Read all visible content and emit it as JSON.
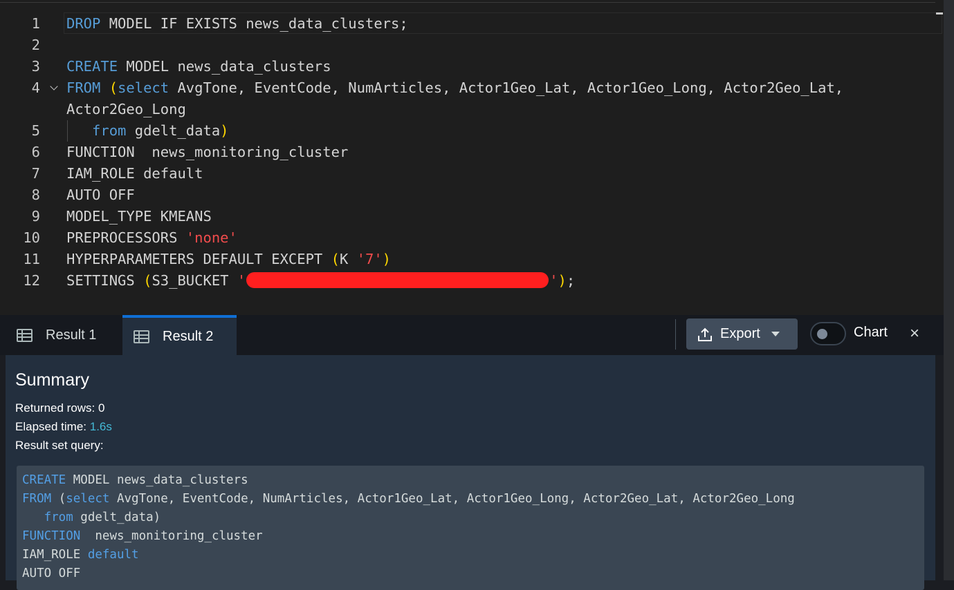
{
  "editor": {
    "lines": [
      {
        "num": "1",
        "parts": [
          {
            "t": "DROP",
            "c": "kw"
          },
          {
            "t": " MODEL IF EXISTS news_data_clusters;"
          }
        ]
      },
      {
        "num": "2",
        "parts": []
      },
      {
        "num": "3",
        "parts": [
          {
            "t": "CREATE",
            "c": "kw"
          },
          {
            "t": " MODEL news_data_clusters"
          }
        ]
      },
      {
        "num": "4",
        "fold": true,
        "parts": [
          {
            "t": "FROM",
            "c": "kw"
          },
          {
            "t": " "
          },
          {
            "t": "(",
            "c": "par"
          },
          {
            "t": "select",
            "c": "kw"
          },
          {
            "t": " AvgTone, EventCode, NumArticles, Actor1Geo_Lat, Actor1Geo_Long, Actor2Geo_Lat,"
          }
        ]
      },
      {
        "num": "",
        "parts": [
          {
            "t": "Actor2Geo_Long"
          }
        ]
      },
      {
        "num": "5",
        "parts": [
          {
            "t": "   "
          },
          {
            "t": "from",
            "c": "kw"
          },
          {
            "t": " gdelt_data"
          },
          {
            "t": ")",
            "c": "par"
          }
        ]
      },
      {
        "num": "6",
        "parts": [
          {
            "t": "FUNCTION  news_monitoring_cluster"
          }
        ]
      },
      {
        "num": "7",
        "parts": [
          {
            "t": "IAM_ROLE default"
          }
        ]
      },
      {
        "num": "8",
        "parts": [
          {
            "t": "AUTO OFF"
          }
        ]
      },
      {
        "num": "9",
        "parts": [
          {
            "t": "MODEL_TYPE KMEANS"
          }
        ]
      },
      {
        "num": "10",
        "parts": [
          {
            "t": "PREPROCESSORS "
          },
          {
            "t": "'none'",
            "c": "str"
          }
        ]
      },
      {
        "num": "11",
        "parts": [
          {
            "t": "HYPERPARAMETERS DEFAULT EXCEPT "
          },
          {
            "t": "(",
            "c": "par"
          },
          {
            "t": "K "
          },
          {
            "t": "'7'",
            "c": "str"
          },
          {
            "t": ")",
            "c": "par"
          }
        ]
      },
      {
        "num": "12",
        "parts": [
          {
            "t": "SETTINGS "
          },
          {
            "t": "(",
            "c": "par"
          },
          {
            "t": "S3_BUCKET "
          },
          {
            "t": "'",
            "c": "str"
          },
          {
            "redact": true
          },
          {
            "t": "'",
            "c": "str"
          },
          {
            "t": ")",
            "c": "par"
          },
          {
            "t": ";"
          }
        ]
      }
    ]
  },
  "tabs": [
    {
      "label": "Result 1",
      "active": false
    },
    {
      "label": "Result 2",
      "active": true
    }
  ],
  "toolbar": {
    "export_label": "Export",
    "chart_label": "Chart",
    "chart_toggle_on": false,
    "close_symbol": "×"
  },
  "summary": {
    "title": "Summary",
    "returned_rows_label": "Returned rows: 0",
    "elapsed_label": "Elapsed time:",
    "elapsed_value": "1.6s",
    "result_set_label": "Result set query:"
  },
  "query": {
    "lines": [
      [
        {
          "t": "CREATE",
          "c": "kw"
        },
        {
          "t": " MODEL news_data_clusters"
        }
      ],
      [
        {
          "t": "FROM",
          "c": "kw"
        },
        {
          "t": " ("
        },
        {
          "t": "select",
          "c": "kw"
        },
        {
          "t": " AvgTone, EventCode, NumArticles, Actor1Geo_Lat, Actor1Geo_Long, Actor2Geo_Lat, Actor2Geo_Long"
        }
      ],
      [
        {
          "t": "   "
        },
        {
          "t": "from",
          "c": "kw"
        },
        {
          "t": " gdelt_data)"
        }
      ],
      [
        {
          "t": "FUNCTION",
          "c": "kw"
        },
        {
          "t": "  news_monitoring_cluster"
        }
      ],
      [
        {
          "t": "IAM_ROLE "
        },
        {
          "t": "default",
          "c": "kw"
        }
      ],
      [
        {
          "t": "AUTO OFF"
        }
      ]
    ]
  },
  "colors": {
    "keyword": "#569cd6",
    "string": "#f14c4c",
    "bracket": "#ffd700",
    "active_tab_border": "#0f6fd5",
    "elapsed_value": "#44b9d6"
  },
  "icons": {
    "tab_icon": "table-icon",
    "export_icon": "upload-icon",
    "dropdown_icon": "caret-down-icon",
    "fold_icon": "chevron-down-icon",
    "close_icon": "close-icon"
  }
}
